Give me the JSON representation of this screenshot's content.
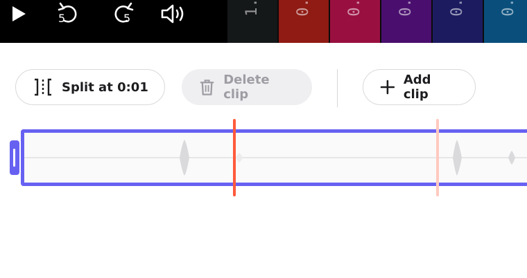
{
  "player": {
    "controls": [
      {
        "name": "play-button",
        "icon": "play-icon"
      },
      {
        "name": "rewind-5-button",
        "icon": "rewind-5-icon",
        "label": "5"
      },
      {
        "name": "forward-5-button",
        "icon": "forward-5-icon",
        "label": "5"
      },
      {
        "name": "volume-button",
        "icon": "volume-icon"
      }
    ],
    "filmstrip": [
      {
        "text": "1.",
        "color": "#151819"
      },
      {
        "text": "0.",
        "color": "#8f1b14"
      },
      {
        "text": "0.",
        "color": "#991040"
      },
      {
        "text": "0.",
        "color": "#4a0f6e"
      },
      {
        "text": "0.",
        "color": "#1c1b60"
      },
      {
        "text": "0.",
        "color": "#0a4f7c"
      }
    ]
  },
  "toolbar": {
    "split_label": "Split at 0:01",
    "delete_label": "Delete clip",
    "add_label": "Add clip"
  },
  "timeline": {
    "accent": "#6761f2",
    "playhead_color": "#ff5a3c",
    "marker_color": "#ffc9bf"
  }
}
